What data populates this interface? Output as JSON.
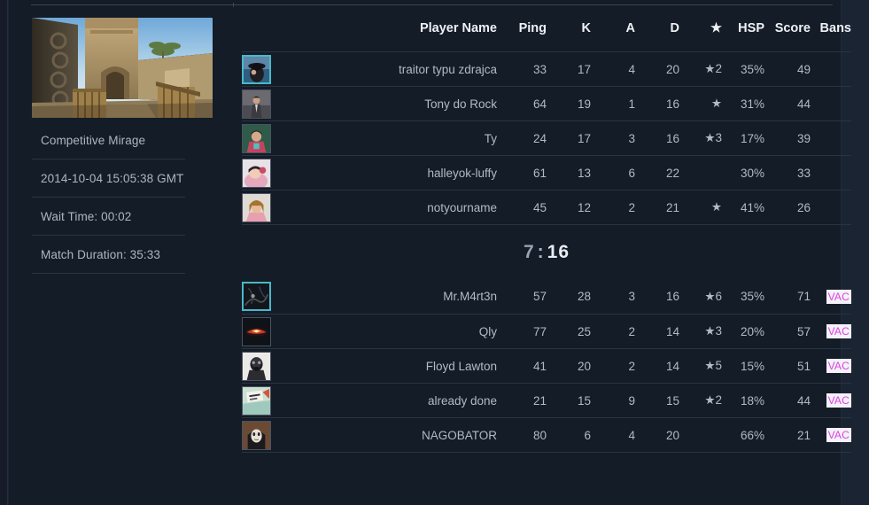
{
  "sidebar": {
    "map_thumbnail": "map-mirage-thumbnail",
    "meta": [
      {
        "key": "mode_map",
        "text": "Competitive Mirage"
      },
      {
        "key": "timestamp",
        "text": "2014-10-04 15:05:38 GMT"
      },
      {
        "key": "wait_time",
        "text": "Wait Time: 00:02"
      },
      {
        "key": "match_duration",
        "text": "Match Duration: 35:33"
      }
    ]
  },
  "board": {
    "columns": [
      {
        "key": "name",
        "label": "Player Name"
      },
      {
        "key": "ping",
        "label": "Ping"
      },
      {
        "key": "k",
        "label": "K"
      },
      {
        "key": "a",
        "label": "A"
      },
      {
        "key": "d",
        "label": "D"
      },
      {
        "key": "mvp",
        "label": "★"
      },
      {
        "key": "hsp",
        "label": "HSP"
      },
      {
        "key": "score",
        "label": "Score"
      },
      {
        "key": "bans",
        "label": "Bans"
      }
    ],
    "score": {
      "team_a": "7",
      "separator": ":",
      "team_b": "16",
      "display": "7 : 16"
    },
    "team_a": [
      {
        "avatar": "avatar-traitor-typu-zdrajca",
        "highlighted": true,
        "name": "traitor typu zdrajca",
        "ping": "33",
        "k": "17",
        "a": "4",
        "d": "20",
        "mvp": "★2",
        "hsp": "35%",
        "score": "49",
        "bans": ""
      },
      {
        "avatar": "avatar-tony-do-rock",
        "highlighted": false,
        "name": "Tony do Rock",
        "ping": "64",
        "k": "19",
        "a": "1",
        "d": "16",
        "mvp": "★",
        "hsp": "31%",
        "score": "44",
        "bans": ""
      },
      {
        "avatar": "avatar-ty",
        "highlighted": false,
        "name": "Ty",
        "ping": "24",
        "k": "17",
        "a": "3",
        "d": "16",
        "mvp": "★3",
        "hsp": "17%",
        "score": "39",
        "bans": ""
      },
      {
        "avatar": "avatar-halleyok-luffy",
        "highlighted": false,
        "name": "halleyok-luffy",
        "ping": "61",
        "k": "13",
        "a": "6",
        "d": "22",
        "mvp": "",
        "hsp": "30%",
        "score": "33",
        "bans": ""
      },
      {
        "avatar": "avatar-notyourname",
        "highlighted": false,
        "name": "notyourname",
        "ping": "45",
        "k": "12",
        "a": "2",
        "d": "21",
        "mvp": "★",
        "hsp": "41%",
        "score": "26",
        "bans": ""
      }
    ],
    "team_b": [
      {
        "avatar": "avatar-mr-m4rt3n",
        "highlighted": true,
        "name": "Mr.M4rt3n",
        "ping": "57",
        "k": "28",
        "a": "3",
        "d": "16",
        "mvp": "★6",
        "hsp": "35%",
        "score": "71",
        "bans": "VAC"
      },
      {
        "avatar": "avatar-qly",
        "highlighted": false,
        "name": "Qly",
        "ping": "77",
        "k": "25",
        "a": "2",
        "d": "14",
        "mvp": "★3",
        "hsp": "20%",
        "score": "57",
        "bans": "VAC"
      },
      {
        "avatar": "avatar-floyd-lawton",
        "highlighted": false,
        "name": "Floyd Lawton",
        "ping": "41",
        "k": "20",
        "a": "2",
        "d": "14",
        "mvp": "★5",
        "hsp": "15%",
        "score": "51",
        "bans": "VAC"
      },
      {
        "avatar": "avatar-already-done",
        "highlighted": false,
        "name": "already done",
        "ping": "21",
        "k": "15",
        "a": "9",
        "d": "15",
        "mvp": "★2",
        "hsp": "18%",
        "score": "44",
        "bans": "VAC"
      },
      {
        "avatar": "avatar-nagobator",
        "highlighted": false,
        "name": "NAGOBATOR",
        "ping": "80",
        "k": "6",
        "a": "4",
        "d": "20",
        "mvp": "",
        "hsp": "66%",
        "score": "21",
        "bans": "VAC"
      }
    ]
  },
  "colors": {
    "page_background": "#1b2433",
    "panel_background": "#131c27",
    "row_divider": "#2a3340",
    "header_text": "#eef1f5",
    "body_text": "#b3bac5",
    "highlight_border": "#4ab7c9",
    "vac_background": "#f2f2f8",
    "vac_text": "#e23fe2"
  }
}
